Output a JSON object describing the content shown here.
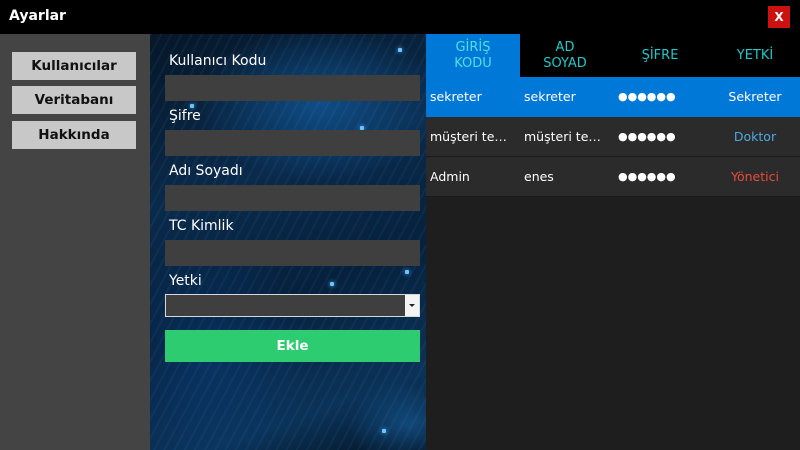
{
  "window": {
    "title": "Ayarlar",
    "close_label": "X"
  },
  "sidebar": {
    "items": [
      {
        "label": "Kullanıcılar"
      },
      {
        "label": "Veritabanı"
      },
      {
        "label": "Hakkında"
      }
    ]
  },
  "form": {
    "fields": [
      {
        "label": "Kullanıcı Kodu",
        "value": ""
      },
      {
        "label": "Şifre",
        "value": ""
      },
      {
        "label": "Adı Soyadı",
        "value": ""
      },
      {
        "label": "TC Kimlik",
        "value": ""
      }
    ],
    "role_label": "Yetki",
    "role_value": "",
    "submit_label": "Ekle"
  },
  "grid": {
    "columns": [
      {
        "label": "GİRİŞ KODU"
      },
      {
        "label": "AD SOYAD"
      },
      {
        "label": "ŞİFRE"
      },
      {
        "label": "YETKİ"
      }
    ],
    "rows": [
      {
        "code": "sekreter",
        "name": "sekreter",
        "password": "●●●●●●",
        "role": "Sekreter",
        "role_color": "#ffffff"
      },
      {
        "code": "müşteri temsilcisi",
        "name": "müşteri temsilcisi",
        "password": "●●●●●●",
        "role": "Doktor",
        "role_color": "#4ea8de"
      },
      {
        "code": "Admin",
        "name": "enes",
        "password": "●●●●●●",
        "role": "Yönetici",
        "role_color": "#e74c3c"
      }
    ]
  },
  "colors": {
    "accent": "#0078d7",
    "submit": "#2ecc71",
    "close": "#cc1111",
    "header_text": "#22c8c8"
  }
}
